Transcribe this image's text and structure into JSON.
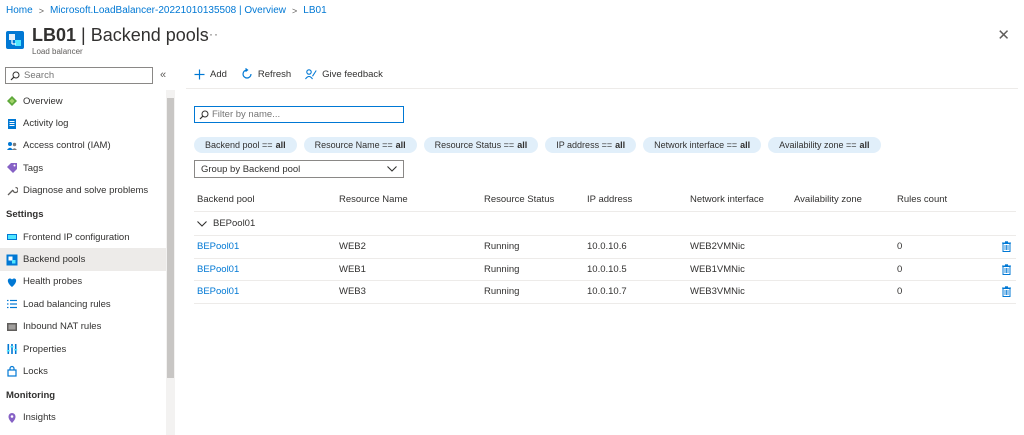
{
  "breadcrumb": [
    "Home",
    "Microsoft.LoadBalancer-20221010135508 | Overview",
    "LB01"
  ],
  "header": {
    "resource_name": "LB01",
    "page_name": "Backend pools",
    "separator": " | ",
    "subtitle": "Load balancer",
    "more": "···",
    "close": "✕"
  },
  "sidebar": {
    "search_placeholder": "Search",
    "collapse": "«",
    "items_top": [
      {
        "label": "Overview",
        "icon": "overview-icon"
      },
      {
        "label": "Activity log",
        "icon": "activity-log-icon"
      },
      {
        "label": "Access control (IAM)",
        "icon": "people-icon"
      },
      {
        "label": "Tags",
        "icon": "tag-icon"
      },
      {
        "label": "Diagnose and solve problems",
        "icon": "wrench-icon"
      }
    ],
    "section_settings": "Settings",
    "items_settings": [
      {
        "label": "Frontend IP configuration",
        "icon": "frontend-ip-icon"
      },
      {
        "label": "Backend pools",
        "icon": "backend-pools-icon",
        "active": true
      },
      {
        "label": "Health probes",
        "icon": "health-probe-icon"
      },
      {
        "label": "Load balancing rules",
        "icon": "rules-icon"
      },
      {
        "label": "Inbound NAT rules",
        "icon": "nat-icon"
      },
      {
        "label": "Properties",
        "icon": "properties-icon"
      },
      {
        "label": "Locks",
        "icon": "lock-icon"
      }
    ],
    "section_monitoring": "Monitoring",
    "items_monitoring": [
      {
        "label": "Insights",
        "icon": "insights-icon"
      }
    ]
  },
  "toolbar": {
    "add": "Add",
    "refresh": "Refresh",
    "feedback": "Give feedback"
  },
  "filter": {
    "placeholder": "Filter by name..."
  },
  "pills": [
    {
      "label": "Backend pool ==",
      "value": "all"
    },
    {
      "label": "Resource Name ==",
      "value": "all"
    },
    {
      "label": "Resource Status ==",
      "value": "all"
    },
    {
      "label": "IP address ==",
      "value": "all"
    },
    {
      "label": "Network interface ==",
      "value": "all"
    },
    {
      "label": "Availability zone ==",
      "value": "all"
    }
  ],
  "groupby": {
    "selected": "Group by Backend pool"
  },
  "table": {
    "columns": [
      "Backend pool",
      "Resource Name",
      "Resource Status",
      "IP address",
      "Network interface",
      "Availability zone",
      "Rules count"
    ],
    "group_label": "BEPool01",
    "rows": [
      [
        "BEPool01",
        "WEB2",
        "Running",
        "10.0.10.6",
        "WEB2VMNic",
        "",
        "0"
      ],
      [
        "BEPool01",
        "WEB1",
        "Running",
        "10.0.10.5",
        "WEB1VMNic",
        "",
        "0"
      ],
      [
        "BEPool01",
        "WEB3",
        "Running",
        "10.0.10.7",
        "WEB3VMNic",
        "",
        "0"
      ]
    ]
  },
  "colors": {
    "accent": "#0078d4",
    "pill_bg": "#e1effa",
    "active_nav_bg": "#edebe9"
  }
}
